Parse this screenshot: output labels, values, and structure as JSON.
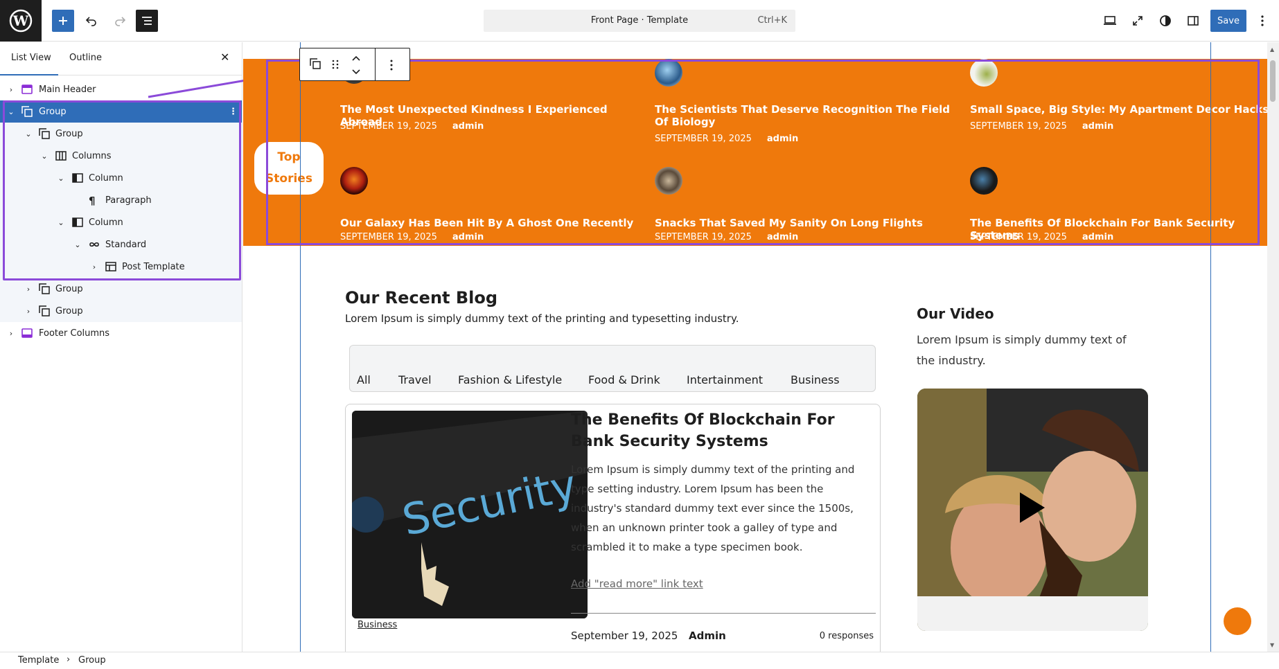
{
  "topbar": {
    "doc_title": "Front Page · Template",
    "shortcut": "Ctrl+K",
    "save_label": "Save"
  },
  "sidebar": {
    "tabs": [
      "List View",
      "Outline"
    ],
    "tree": [
      {
        "label": "Main Header",
        "icon": "template-part-icon"
      },
      {
        "label": "Group",
        "icon": "group-icon"
      },
      {
        "label": "Group",
        "icon": "group-icon"
      },
      {
        "label": "Columns",
        "icon": "columns-icon"
      },
      {
        "label": "Column",
        "icon": "column-icon"
      },
      {
        "label": "Paragraph",
        "icon": "paragraph-icon"
      },
      {
        "label": "Column",
        "icon": "column-icon"
      },
      {
        "label": "Standard",
        "icon": "loop-icon"
      },
      {
        "label": "Post Template",
        "icon": "layout-icon"
      },
      {
        "label": "Group",
        "icon": "group-icon"
      },
      {
        "label": "Group",
        "icon": "group-icon"
      },
      {
        "label": "Footer Columns",
        "icon": "template-part-icon"
      }
    ]
  },
  "top_stories": {
    "label_line1": "Top",
    "label_line2": "Stories",
    "stories": [
      {
        "title": "The Most Unexpected Kindness I Experienced Abroad",
        "date": "SEPTEMBER 19, 2025",
        "author": "admin"
      },
      {
        "title": "The Scientists That Deserve Recognition The Field Of Biology",
        "date": "SEPTEMBER 19, 2025",
        "author": "admin"
      },
      {
        "title": "Small Space, Big Style: My Apartment Decor Hacks",
        "date": "SEPTEMBER 19, 2025",
        "author": "admin"
      },
      {
        "title": "Our Galaxy Has Been Hit By A Ghost One Recently",
        "date": "SEPTEMBER 19, 2025",
        "author": "admin"
      },
      {
        "title": "Snacks That Saved My Sanity On Long Flights",
        "date": "SEPTEMBER 19, 2025",
        "author": "admin"
      },
      {
        "title": "The Benefits Of Blockchain For Bank Security Systems",
        "date": "SEPTEMBER 19, 2025",
        "author": "admin"
      }
    ]
  },
  "blog": {
    "heading": "Our Recent Blog",
    "intro": "Lorem Ipsum is simply dummy text of the printing and typesetting industry.",
    "filters": [
      "All",
      "Travel",
      "Fashion & Lifestyle",
      "Food & Drink",
      "Intertainment",
      "Business"
    ],
    "card": {
      "image_text": "Security",
      "title": "The Benefits Of Blockchain For Bank Security Systems",
      "excerpt": "Lorem Ipsum is simply dummy text of the printing and type setting industry. Lorem Ipsum has been the industry's standard dummy text ever since the 1500s, when an unknown printer took a galley of type and scrambled it to make a type specimen book.",
      "read_more": "Add \"read more\" link text",
      "category": "Business",
      "date": "September 19, 2025",
      "author": "Admin",
      "responses": "0 responses"
    }
  },
  "video": {
    "heading": "Our Video",
    "text": "Lorem Ipsum is simply dummy text of the industry."
  },
  "breadcrumb": [
    "Template",
    "Group"
  ],
  "colors": {
    "accent": "#ef790c",
    "wp_blue": "#2f6db8",
    "highlight": "#8b4ad9"
  }
}
